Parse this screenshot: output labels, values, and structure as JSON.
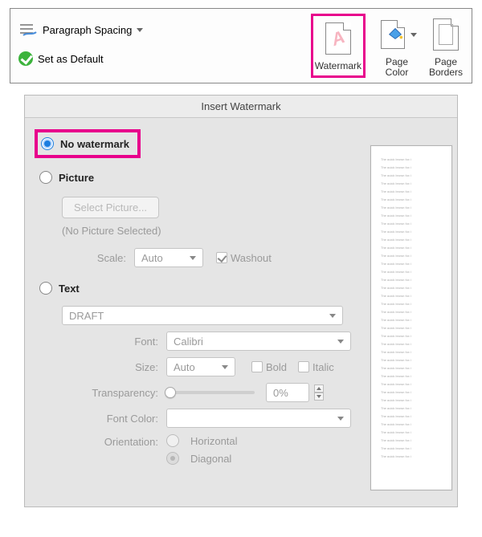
{
  "ribbon": {
    "paragraph_spacing": "Paragraph Spacing",
    "set_default": "Set as Default",
    "watermark": "Watermark",
    "page_color": "Page\nColor",
    "page_borders": "Page\nBorders"
  },
  "dialog": {
    "title": "Insert Watermark",
    "option_none": "No watermark",
    "option_picture": "Picture",
    "select_picture_btn": "Select Picture...",
    "no_picture_selected": "(No Picture Selected)",
    "scale_label": "Scale:",
    "scale_value": "Auto",
    "washout_label": "Washout",
    "option_text": "Text",
    "text_value": "DRAFT",
    "font_label": "Font:",
    "font_value": "Calibri",
    "size_label": "Size:",
    "size_value": "Auto",
    "bold_label": "Bold",
    "italic_label": "Italic",
    "transparency_label": "Transparency:",
    "transparency_value": "0%",
    "font_color_label": "Font Color:",
    "orientation_label": "Orientation:",
    "orientation_h": "Horizontal",
    "orientation_d": "Diagonal",
    "preview_line": "The quick brown fox j",
    "selected_option": "none",
    "orientation_selected": "diagonal",
    "washout_checked": true
  },
  "highlight_color": "#e8008c"
}
